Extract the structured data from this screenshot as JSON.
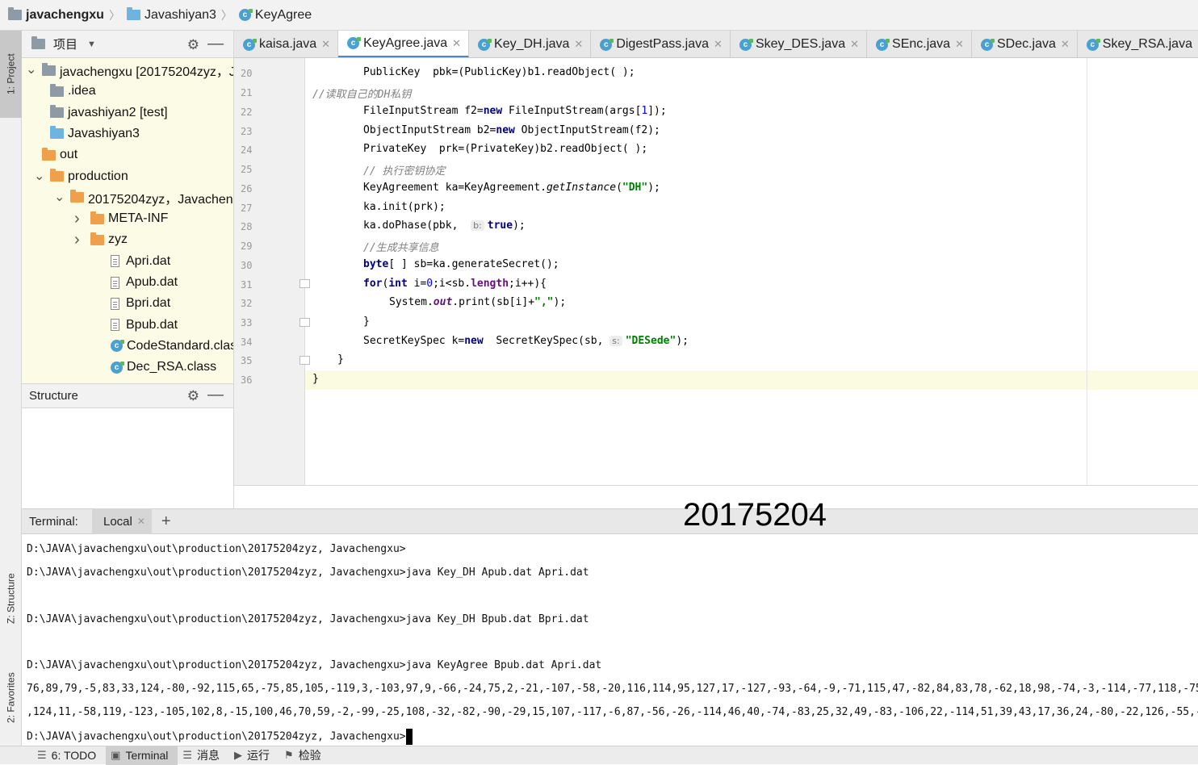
{
  "breadcrumb": {
    "project": "javachengxu",
    "module": "Javashiyan3",
    "file": "KeyAgree"
  },
  "left_tabs": {
    "project": "1: Project",
    "structure": "Z: Structure",
    "favorites": "2: Favorites"
  },
  "project_panel": {
    "title": "项目",
    "tree": [
      {
        "text": "javachengxu [20175204zyz，Javac",
        "icon": "folder-gray",
        "arrow": "expanded",
        "level": 0
      },
      {
        "text": ".idea",
        "icon": "folder-gray",
        "arrow": "none",
        "level": 1
      },
      {
        "text": "javashiyan2 [test]",
        "icon": "folder-gray",
        "arrow": "none",
        "level": 1
      },
      {
        "text": "Javashiyan3",
        "icon": "folder-blue",
        "arrow": "none",
        "level": 1
      },
      {
        "text": "out",
        "icon": "folder-orange",
        "arrow": "none",
        "level": 0
      },
      {
        "text": "production",
        "icon": "folder-orange",
        "arrow": "expanded",
        "level": 1
      },
      {
        "text": "20175204zyz，Javachen",
        "icon": "folder-orange",
        "arrow": "expanded",
        "level": 2
      },
      {
        "text": "META-INF",
        "icon": "folder-orange",
        "arrow": "collapsed",
        "level": 3
      },
      {
        "text": "zyz",
        "icon": "folder-orange",
        "arrow": "collapsed",
        "level": 3
      },
      {
        "text": "Apri.dat",
        "icon": "file",
        "arrow": "none",
        "level": 4
      },
      {
        "text": "Apub.dat",
        "icon": "file",
        "arrow": "none",
        "level": 4
      },
      {
        "text": "Bpri.dat",
        "icon": "file",
        "arrow": "none",
        "level": 4
      },
      {
        "text": "Bpub.dat",
        "icon": "file",
        "arrow": "none",
        "level": 4
      },
      {
        "text": "CodeStandard.class",
        "icon": "class",
        "arrow": "none",
        "level": 4
      },
      {
        "text": "Dec_RSA.class",
        "icon": "class",
        "arrow": "none",
        "level": 4
      }
    ]
  },
  "structure_panel": {
    "title": "Structure"
  },
  "tabs": [
    {
      "label": "kaisa.java",
      "active": false
    },
    {
      "label": "KeyAgree.java",
      "active": true
    },
    {
      "label": "Key_DH.java",
      "active": false
    },
    {
      "label": "DigestPass.java",
      "active": false
    },
    {
      "label": "Skey_DES.java",
      "active": false
    },
    {
      "label": "SEnc.java",
      "active": false
    },
    {
      "label": "SDec.java",
      "active": false
    },
    {
      "label": "Skey_RSA.java",
      "active": false
    }
  ],
  "code": {
    "line_numbers": [
      "20",
      "21",
      "22",
      "23",
      "24",
      "25",
      "26",
      "27",
      "28",
      "29",
      "30",
      "31",
      "32",
      "33",
      "34",
      "35",
      "36"
    ],
    "hints": {
      "b": "b:",
      "s": "s:"
    }
  },
  "terminal": {
    "label": "Terminal:",
    "tab": "Local",
    "watermark": "20175204",
    "lines": [
      "D:\\JAVA\\javachengxu\\out\\production\\20175204zyz, Javachengxu>",
      "D:\\JAVA\\javachengxu\\out\\production\\20175204zyz, Javachengxu>java Key_DH Apub.dat Apri.dat",
      "D:\\JAVA\\javachengxu\\out\\production\\20175204zyz, Javachengxu>java Key_DH Bpub.dat Bpri.dat",
      "D:\\JAVA\\javachengxu\\out\\production\\20175204zyz, Javachengxu>java KeyAgree Bpub.dat Apri.dat",
      "76,89,79,-5,83,33,124,-80,-92,115,65,-75,85,105,-119,3,-103,97,9,-66,-24,75,2,-21,-107,-58,-20,116,114,95,127,17,-127,-93,-64,-9,-71,115,47,-82,84,83,78,-62,18,98,-74,-3,-114,-77,118,-75,-100,-5",
      ",124,11,-58,119,-123,-105,102,8,-15,100,46,70,59,-2,-99,-25,108,-32,-82,-90,-29,15,107,-117,-6,87,-56,-26,-114,46,40,-74,-83,25,32,49,-83,-106,22,-114,51,39,43,17,36,24,-80,-22,126,-55,-124,-51,",
      "D:\\JAVA\\javachengxu\\out\\production\\20175204zyz, Javachengxu>"
    ]
  },
  "bottom_bar": [
    {
      "label": "6: TODO",
      "icon": "list-icon",
      "active": false
    },
    {
      "label": "Terminal",
      "icon": "terminal-icon",
      "active": true
    },
    {
      "label": "消息",
      "icon": "messages-icon",
      "active": false
    },
    {
      "label": "运行",
      "icon": "run-icon",
      "active": false
    },
    {
      "label": "检验",
      "icon": "inspect-icon",
      "active": false
    }
  ]
}
